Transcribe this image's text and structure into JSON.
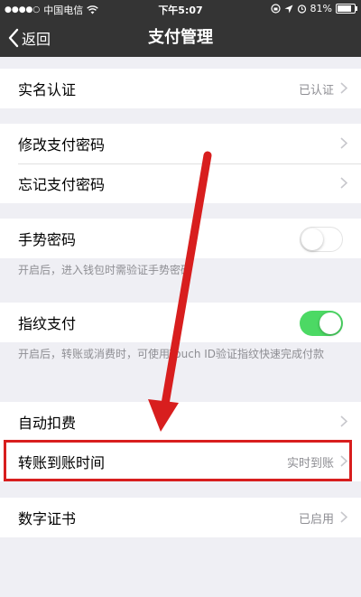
{
  "status_bar": {
    "signal_dots": "●●●●○",
    "carrier": "中国电信",
    "time": "下午5:07",
    "battery": "81%",
    "battery_level": 0.81,
    "alarm_icon": "alarm-clock-icon",
    "location_icon": "location-arrow-icon",
    "lock_icon": "orientation-lock-icon"
  },
  "nav": {
    "back_label": "返回",
    "title": "支付管理"
  },
  "rows": {
    "real_name": {
      "label": "实名认证",
      "value": "已认证"
    },
    "change_pwd": {
      "label": "修改支付密码"
    },
    "forgot_pwd": {
      "label": "忘记支付密码"
    },
    "gesture": {
      "label": "手势密码",
      "toggle": "off",
      "hint": "开启后，进入钱包时需验证手势密码"
    },
    "fingerprint": {
      "label": "指纹支付",
      "toggle": "on",
      "hint": "开启后，转账或消费时，可使用Touch ID验证指纹快速完成付款"
    },
    "auto_deduct": {
      "label": "自动扣费"
    },
    "transfer_time": {
      "label": "转账到账时间",
      "value": "实时到账"
    },
    "certificate": {
      "label": "数字证书",
      "value": "已启用"
    }
  },
  "colors": {
    "nav_bg": "#343434",
    "page_bg": "#efeff4",
    "toggle_on": "#4cd964",
    "annotation_red": "#d81e1e"
  }
}
